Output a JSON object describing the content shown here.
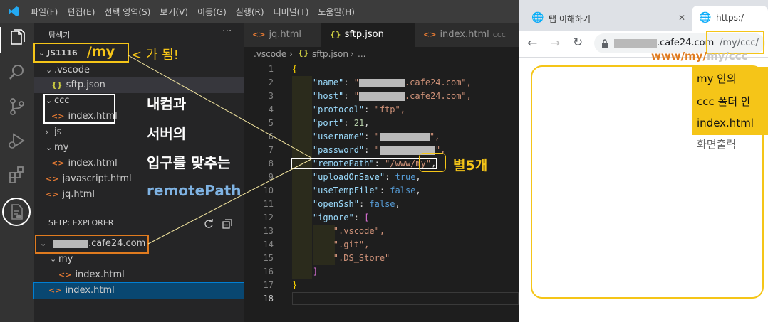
{
  "menu": [
    "파일(F)",
    "편집(E)",
    "선택 영역(S)",
    "보기(V)",
    "이동(G)",
    "실행(R)",
    "터미널(T)",
    "도움말(H)"
  ],
  "explorer": {
    "title": "탐색기",
    "more": "···",
    "root": "JS1116",
    "items": [
      ".vscode",
      "sftp.json",
      "ccc",
      "index.html",
      "js",
      "my",
      "index.html",
      "javascript.html",
      "jq.html"
    ]
  },
  "sftp_explorer": {
    "title": "SFTP: EXPLORER",
    "host_suffix": ".cafe24.com",
    "items": [
      "my",
      "index.html",
      "index.html"
    ]
  },
  "tabs": [
    {
      "label": "jq.html",
      "hint": ""
    },
    {
      "label": "sftp.json",
      "hint": ""
    },
    {
      "label": "index.html",
      "hint": "ccc"
    }
  ],
  "breadcrumb": {
    "folder": ".vscode",
    "file": "sftp.json",
    "rest": "..."
  },
  "code": {
    "line_numbers": [
      "1",
      "2",
      "3",
      "4",
      "5",
      "6",
      "7",
      "8",
      "9",
      "10",
      "11",
      "12",
      "13",
      "14",
      "15",
      "16",
      "17",
      "18"
    ],
    "name_key": "\"name\"",
    "name_val": ".cafe24.com\",",
    "host_key": "\"host\"",
    "host_val": ".cafe24.com\",",
    "protocol_key": "\"protocol\"",
    "protocol_val": "\"ftp\",",
    "port_key": "\"port\"",
    "port_val": "21",
    "username_key": "\"username\"",
    "password_key": "\"password\"",
    "remote_key": "\"remotePath\"",
    "remote_val": "\"/www/my\"",
    "upload_key": "\"uploadOnSave\"",
    "upload_val": "true",
    "temp_key": "\"useTempFile\"",
    "temp_val": "false",
    "ssh_key": "\"openSsh\"",
    "ssh_val": "false",
    "ignore_key": "\"ignore\"",
    "ignore_items": [
      "\".vscode\",",
      "\".git\",",
      "\".DS_Store\""
    ]
  },
  "browser": {
    "tab1": "탭 이해하기",
    "tab2": "https:/",
    "url_domain": ".cafe24.com",
    "url_path": "/my/ccc/"
  },
  "annotations": {
    "my_label": "/my",
    "ga_doem": "가 됨!",
    "line1": "내컴과",
    "line2": "서버의",
    "line3": "입구를 맞추는",
    "remote": "remotePath",
    "stars": "별5개",
    "www_prefix": "www/my/",
    "www_suffix": "my/ccc",
    "box1": "my 안의",
    "box2": "ccc 폴더 안",
    "box3": "index.html",
    "output": "화면출력"
  },
  "colors": {
    "accent": "#f5c518",
    "orange": "#e07b1f",
    "vscode_blue": "#0e639c"
  }
}
